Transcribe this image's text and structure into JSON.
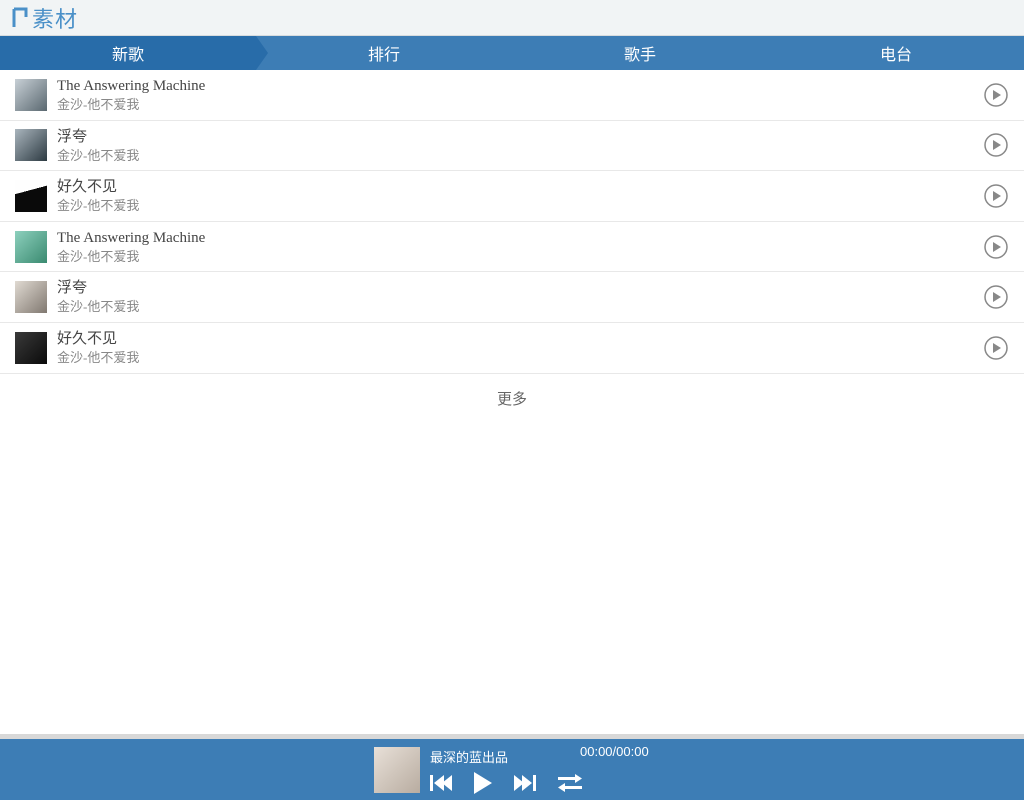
{
  "header": {
    "brand_text": "素材"
  },
  "tabs": [
    {
      "label": "新歌",
      "active": true
    },
    {
      "label": "排行",
      "active": false
    },
    {
      "label": "歌手",
      "active": false
    },
    {
      "label": "电台",
      "active": false
    }
  ],
  "songs": [
    {
      "title": "The Answering Machine",
      "subtitle": "金沙-他不爱我"
    },
    {
      "title": "浮夸",
      "subtitle": "金沙-他不爱我"
    },
    {
      "title": "好久不见",
      "subtitle": "金沙-他不爱我"
    },
    {
      "title": "The Answering Machine",
      "subtitle": "金沙-他不爱我"
    },
    {
      "title": "浮夸",
      "subtitle": "金沙-他不爱我"
    },
    {
      "title": "好久不见",
      "subtitle": "金沙-他不爱我"
    }
  ],
  "load_more": "更多",
  "player": {
    "now_playing": "最深的蓝出品",
    "time": "00:00/00:00"
  }
}
